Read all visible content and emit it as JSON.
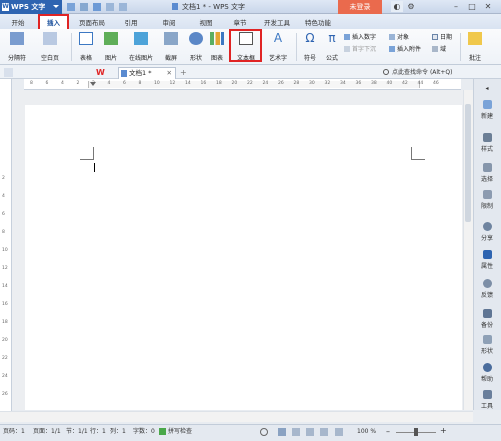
{
  "titlebar": {
    "app_name": "WPS 文字",
    "doc_title": "文档1 * - WPS 文字",
    "login": "未登录",
    "controls": [
      "–",
      "□",
      "✕"
    ]
  },
  "tabs": [
    "开始",
    "插入",
    "页面布局",
    "引用",
    "审阅",
    "视图",
    "章节",
    "开发工具",
    "特色功能"
  ],
  "ribbon": {
    "page_break": "分隔符",
    "blank_page": "空白页",
    "table": "表格",
    "picture": "图片",
    "online_picture": "在线图片",
    "screenshot": "截屏",
    "shape": "形状",
    "chart": "图表",
    "textbox": "文本框",
    "art_text": "艺术字",
    "symbol": "符号",
    "formula": "公式",
    "insert_number": "插入数字",
    "object": "对象",
    "date": "日期",
    "header_footer": "首字下沉",
    "attachment": "插入附件",
    "field": "域",
    "comment": "批注"
  },
  "colors": {
    "accent": "#2e64b1",
    "highlight": "#e02424",
    "login": "#ea6a4d"
  },
  "doc_tab": {
    "name": "文档1 *"
  },
  "search": {
    "placeholder": "点此查找命令",
    "shortcut": "(Alt+Q)"
  },
  "ruler_h": [
    "8",
    "6",
    "4",
    "2",
    "2",
    "4",
    "6",
    "8",
    "10",
    "12",
    "14",
    "16",
    "18",
    "20",
    "22",
    "24",
    "26",
    "28",
    "30",
    "32",
    "34",
    "36",
    "38",
    "40",
    "42",
    "44",
    "46"
  ],
  "ruler_v": [
    "2",
    "4",
    "6",
    "8",
    "10",
    "12",
    "14",
    "16",
    "18",
    "20",
    "22",
    "24",
    "26"
  ],
  "right_panel": [
    "新建",
    "样式",
    "选择",
    "限制",
    "分享",
    "属性",
    "反馈",
    "备份",
    "形状",
    "帮助",
    "工具"
  ],
  "status": {
    "page": "页码：1",
    "pages": "页面：1/1",
    "section": "节：1/1",
    "row": "行：1",
    "col": "列：1",
    "words": "字数：0",
    "spell": "拼写检查",
    "zoom": "100 %"
  }
}
